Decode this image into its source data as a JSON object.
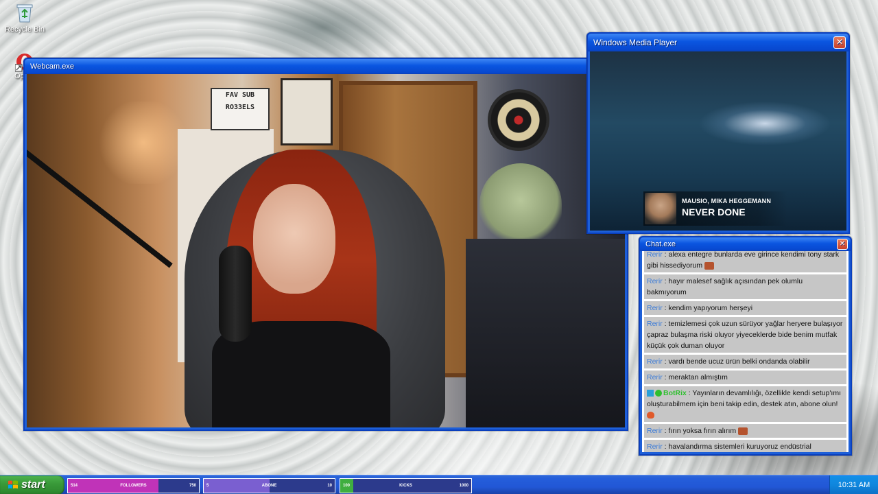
{
  "desktop": {
    "icons": [
      {
        "label": "Recycle Bin",
        "icon": "recycle-bin-icon"
      },
      {
        "label": "Op",
        "icon": "opera-icon"
      }
    ]
  },
  "webcam_window": {
    "title": "Webcam.exe",
    "close_label": "✕",
    "scene_text": {
      "sign_line1": "FAV SUB",
      "sign_line2": "RO33ELS"
    }
  },
  "media_window": {
    "title": "Windows Media Player",
    "close_label": "✕",
    "now_playing": {
      "artist": "MAUSIO, MIKA HEGGEMANN",
      "title": "NEVER DONE"
    }
  },
  "chat_window": {
    "title": "Chat.exe",
    "close_label": "✕",
    "messages": [
      {
        "user": "Rerir",
        "text": "alexa entegre bunlarda eve girince kendimi tony stark gibi hissediyorum",
        "emote": true
      },
      {
        "user": "Rerir",
        "text": "hayır malesef sağlık açısından pek olumlu bakmıyorum",
        "emote": false
      },
      {
        "user": "Rerir",
        "text": "kendim yapıyorum herşeyi",
        "emote": false
      },
      {
        "user": "Rerir",
        "text": "temizlemesi çok uzun sürüyor yağlar heryere bulaşıyor çapraz bulaşma riski oluyor yiyeceklerde bide benim mutfak küçük çok duman oluyor",
        "emote": false
      },
      {
        "user": "Rerir",
        "text": "vardı bende ucuz ürün belki ondanda olabilir",
        "emote": false
      },
      {
        "user": "Rerir",
        "text": "meraktan almıştım",
        "emote": false
      },
      {
        "user": "BotRix",
        "text": "Yayınların devamlılığı, özellikle kendi setup'ımı oluşturabilmem için beni takip edin, destek atın, abone olun!",
        "emote": "heart",
        "bot": true
      },
      {
        "user": "Rerir",
        "text": "fırın yoksa fırın alırım",
        "emote": true
      },
      {
        "user": "Rerir",
        "text": "havalandırma sistemleri kuruyoruz endüstrial mekanlara HVAC diye geçiyor belçikadayım bende",
        "emote": false
      }
    ]
  },
  "taskbar": {
    "start_label": "start",
    "clock": "10:31 AM",
    "goals": [
      {
        "left": "514",
        "label": "FOLLOWERS",
        "right": "750",
        "progress": 0.69,
        "fill_color": "#c033b8"
      },
      {
        "left": "5",
        "label": "ABONE",
        "right": "10",
        "progress": 0.5,
        "fill_color": "#7a5fd0"
      },
      {
        "left": "100",
        "label": "KICKS",
        "right": "1000",
        "progress": 0.1,
        "fill_color": "#3fae3f"
      }
    ]
  },
  "colors": {
    "xp_blue": "#0a55e0",
    "chat_username": "#3b7bd8",
    "bot_username": "#2fbf2f",
    "chat_message_bg": "#c6c6c6"
  }
}
